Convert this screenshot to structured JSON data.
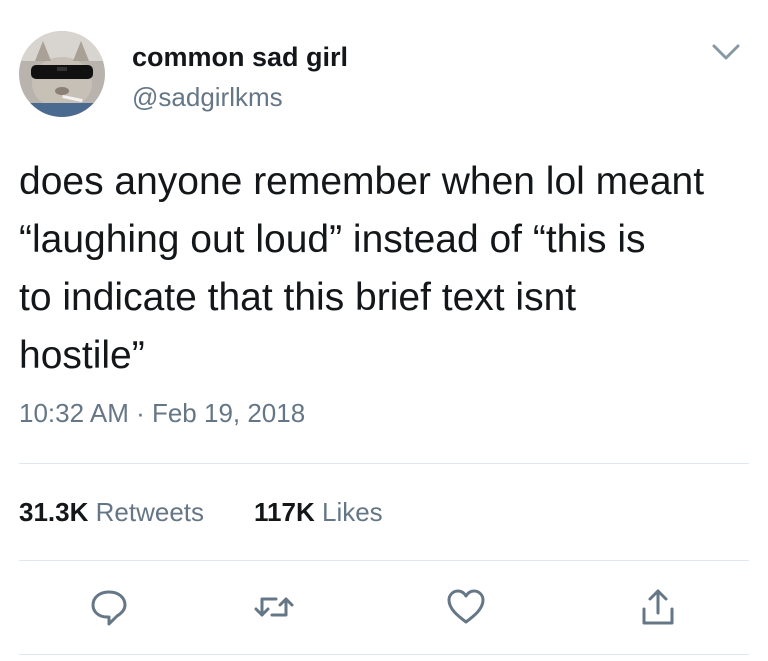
{
  "tweet": {
    "display_name": "common sad girl",
    "handle": "@sadgirlkms",
    "text": "does anyone remember when lol meant\n“laughing out loud” instead of “this is\nto indicate that this brief text isnt\nhostile”",
    "timestamp": "10:32 AM · Feb 19, 2018"
  },
  "stats": {
    "retweets": {
      "count": "31.3K",
      "label": "Retweets"
    },
    "likes": {
      "count": "117K",
      "label": "Likes"
    }
  },
  "icons": {
    "caret": "chevron-down-icon",
    "reply": "reply-icon",
    "retweet": "retweet-icon",
    "like": "heart-icon",
    "share": "share-icon"
  },
  "colors": {
    "text_primary": "#14171a",
    "text_secondary": "#657786",
    "divider": "#e1e8ed",
    "background": "#ffffff"
  }
}
